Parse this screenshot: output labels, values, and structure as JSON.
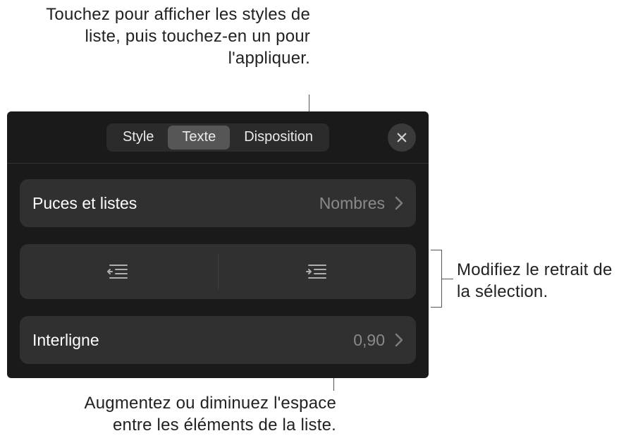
{
  "callouts": {
    "top": "Touchez pour afficher les styles de liste, puis touchez-en un pour l'appliquer.",
    "right": "Modifiez le retrait de la sélection.",
    "bottom": "Augmentez ou diminuez l'espace entre les éléments de la liste."
  },
  "tabs": {
    "style": "Style",
    "texte": "Texte",
    "disposition": "Disposition"
  },
  "rows": {
    "bullets_label": "Puces et listes",
    "bullets_value": "Nombres",
    "interline_label": "Interligne",
    "interline_value": "0,90"
  },
  "icons": {
    "close": "close-icon",
    "chevron": "chevron-right-icon",
    "outdent": "outdent-icon",
    "indent": "indent-icon"
  }
}
